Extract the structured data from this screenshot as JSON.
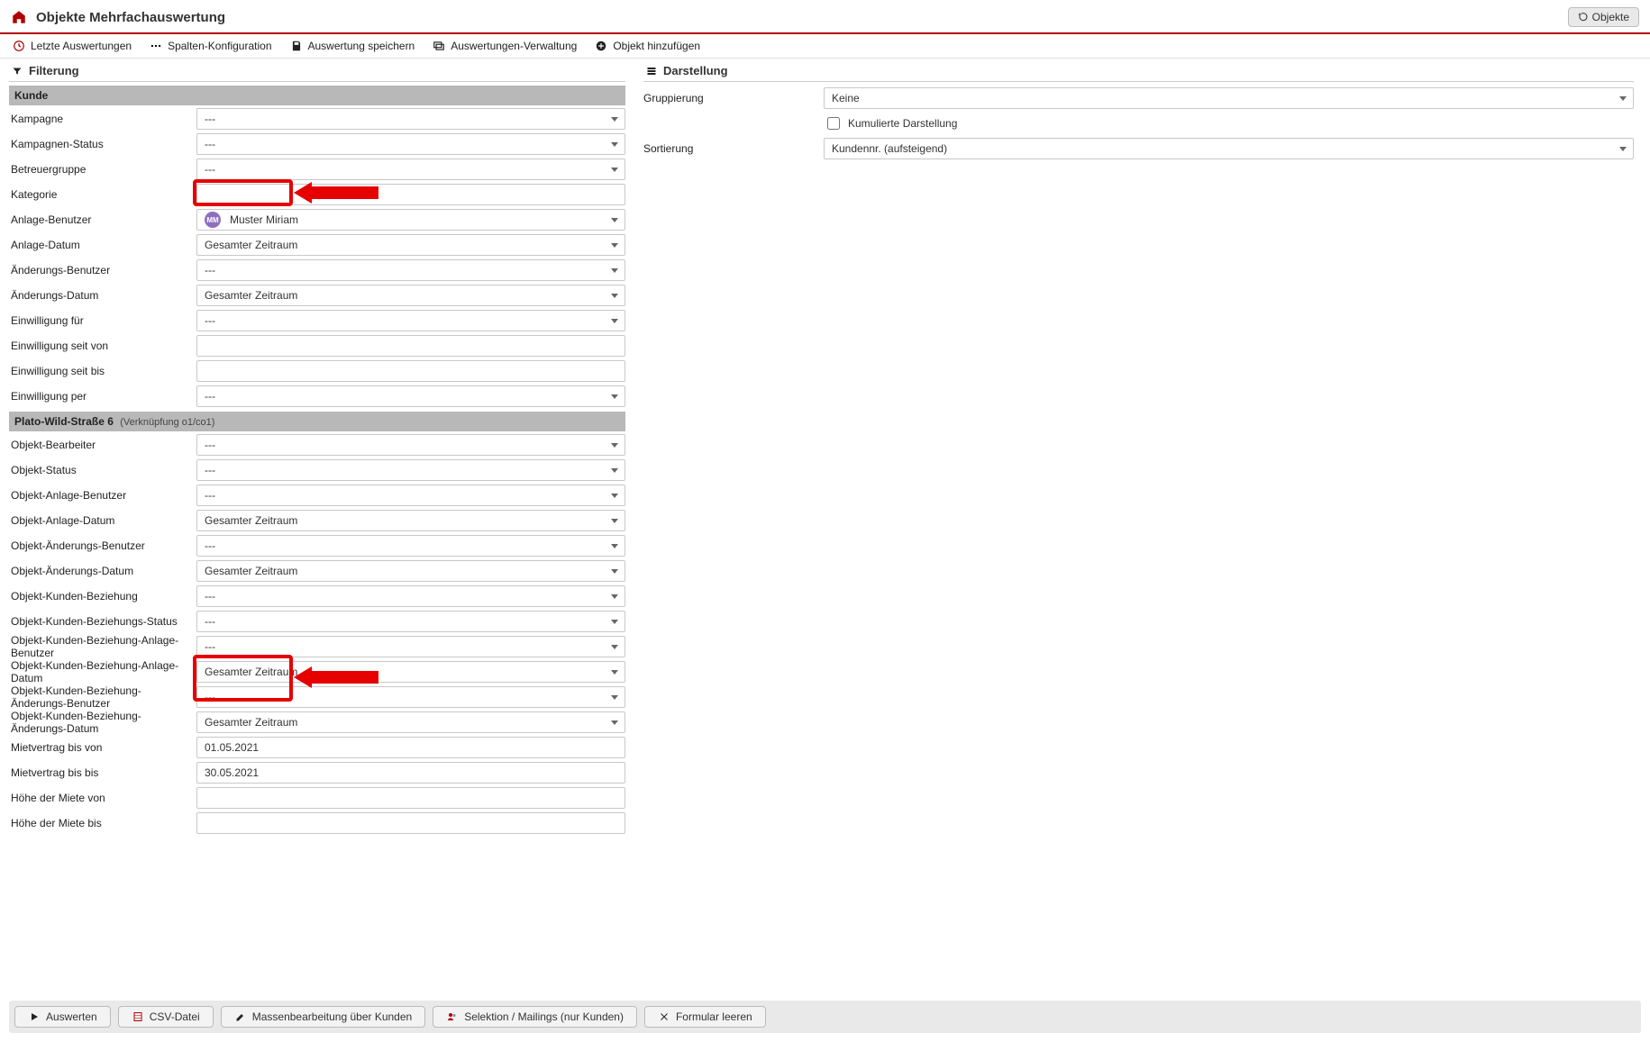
{
  "header": {
    "title": "Objekte Mehrfachauswertung",
    "top_button_label": "Objekte"
  },
  "toolbar": {
    "recent": "Letzte Auswertungen",
    "columns": "Spalten-Konfiguration",
    "save": "Auswertung speichern",
    "manage": "Auswertungen-Verwaltung",
    "add": "Objekt hinzufügen"
  },
  "left": {
    "section_title": "Filterung",
    "group1_title": "Kunde",
    "fields1": {
      "kampagne": {
        "label": "Kampagne",
        "value": "---",
        "type": "select"
      },
      "kampagnen_status": {
        "label": "Kampagnen-Status",
        "value": "---",
        "type": "select"
      },
      "betreuergruppe": {
        "label": "Betreuergruppe",
        "value": "---",
        "type": "select"
      },
      "kategorie": {
        "label": "Kategorie",
        "value": "",
        "type": "text"
      },
      "anlage_benutzer": {
        "label": "Anlage-Benutzer",
        "value": "Muster Miriam",
        "avatar": "MM",
        "type": "select"
      },
      "anlage_datum": {
        "label": "Anlage-Datum",
        "value": "Gesamter Zeitraum",
        "type": "select"
      },
      "aenderungs_benutzer": {
        "label": "Änderungs-Benutzer",
        "value": "---",
        "type": "select"
      },
      "aenderungs_datum": {
        "label": "Änderungs-Datum",
        "value": "Gesamter Zeitraum",
        "type": "select"
      },
      "einwilligung_fuer": {
        "label": "Einwilligung für",
        "value": "---",
        "type": "select"
      },
      "einwilligung_von": {
        "label": "Einwilligung seit von",
        "value": "",
        "type": "text"
      },
      "einwilligung_bis": {
        "label": "Einwilligung seit bis",
        "value": "",
        "type": "text"
      },
      "einwilligung_per": {
        "label": "Einwilligung per",
        "value": "---",
        "type": "select"
      }
    },
    "group2_title": "Plato-Wild-Straße 6",
    "group2_sub": "(Verknüpfung o1/co1)",
    "fields2": {
      "obj_bearbeiter": {
        "label": "Objekt-Bearbeiter",
        "value": "---",
        "type": "select"
      },
      "obj_status": {
        "label": "Objekt-Status",
        "value": "---",
        "type": "select"
      },
      "obj_anl_benutzer": {
        "label": "Objekt-Anlage-Benutzer",
        "value": "---",
        "type": "select"
      },
      "obj_anl_datum": {
        "label": "Objekt-Anlage-Datum",
        "value": "Gesamter Zeitraum",
        "type": "select"
      },
      "obj_aend_benutzer": {
        "label": "Objekt-Änderungs-Benutzer",
        "value": "---",
        "type": "select"
      },
      "obj_aend_datum": {
        "label": "Objekt-Änderungs-Datum",
        "value": "Gesamter Zeitraum",
        "type": "select"
      },
      "okb": {
        "label": "Objekt-Kunden-Beziehung",
        "value": "---",
        "type": "select"
      },
      "okb_status": {
        "label": "Objekt-Kunden-Beziehungs-Status",
        "value": "---",
        "type": "select"
      },
      "okb_anl_benutzer": {
        "label": "Objekt-Kunden-Beziehung-Anlage-Benutzer",
        "value": "---",
        "type": "select"
      },
      "okb_anl_datum": {
        "label": "Objekt-Kunden-Beziehung-Anlage-Datum",
        "value": "Gesamter Zeitraum",
        "type": "select"
      },
      "okb_aend_benutzer": {
        "label": "Objekt-Kunden-Beziehung-Änderungs-Benutzer",
        "value": "---",
        "type": "select"
      },
      "okb_aend_datum": {
        "label": "Objekt-Kunden-Beziehung-Änderungs-Datum",
        "value": "Gesamter Zeitraum",
        "type": "select"
      },
      "mietvertrag_von": {
        "label": "Mietvertrag bis von",
        "value": "01.05.2021",
        "type": "text"
      },
      "mietvertrag_bis": {
        "label": "Mietvertrag bis bis",
        "value": "30.05.2021",
        "type": "text"
      },
      "miete_von": {
        "label": "Höhe der Miete von",
        "value": "",
        "type": "text"
      },
      "miete_bis": {
        "label": "Höhe der Miete bis",
        "value": "",
        "type": "text"
      }
    }
  },
  "right": {
    "section_title": "Darstellung",
    "gruppierung_label": "Gruppierung",
    "gruppierung_value": "Keine",
    "kumuliert_label": "Kumulierte Darstellung",
    "sortierung_label": "Sortierung",
    "sortierung_value": "Kundennr. (aufsteigend)"
  },
  "footer": {
    "auswerten": "Auswerten",
    "csv": "CSV-Datei",
    "massen": "Massenbearbeitung über Kunden",
    "selektion": "Selektion / Mailings (nur Kunden)",
    "leeren": "Formular leeren"
  }
}
